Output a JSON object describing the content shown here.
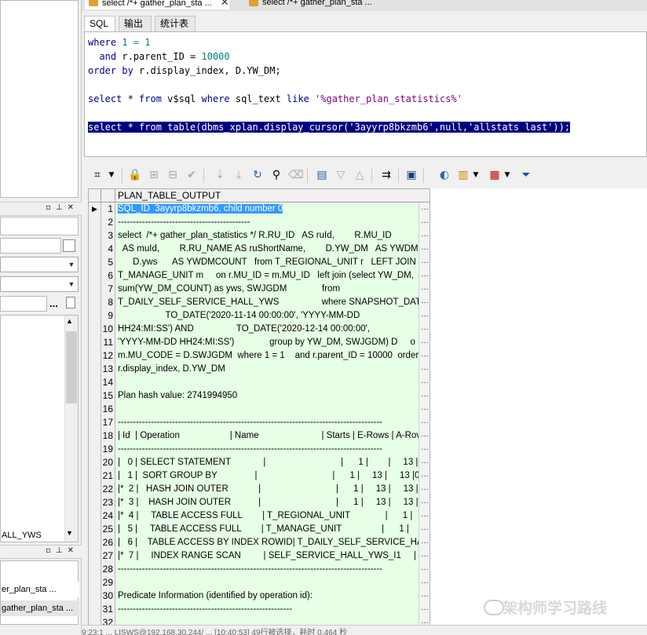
{
  "doc_tabs": [
    {
      "label": "select /*+ gather_plan_sta ..."
    },
    {
      "label": "select /*+ gather_plan_sta ..."
    }
  ],
  "sub_tabs": [
    "SQL",
    "输出",
    "统计表"
  ],
  "editor": {
    "lines": [
      [
        {
          "t": "where",
          "c": "kw"
        },
        {
          "t": " 1 = 1",
          "c": "num"
        }
      ],
      [
        {
          "t": "  and",
          "c": "kw"
        },
        {
          "t": " r.parent_ID = ",
          "c": ""
        },
        {
          "t": "10000",
          "c": "num"
        }
      ],
      [
        {
          "t": "order by",
          "c": "kw"
        },
        {
          "t": " r.display_index, D.YW_DM;",
          "c": ""
        }
      ],
      [],
      [
        {
          "t": "select",
          "c": "kw"
        },
        {
          "t": " * ",
          "c": ""
        },
        {
          "t": "from",
          "c": "kw"
        },
        {
          "t": " v$sql ",
          "c": ""
        },
        {
          "t": "where",
          "c": "kw"
        },
        {
          "t": " sql_text ",
          "c": ""
        },
        {
          "t": "like",
          "c": "kw"
        },
        {
          "t": " ",
          "c": ""
        },
        {
          "t": "'%gather_plan_statistics%'",
          "c": "str"
        }
      ],
      [],
      [
        {
          "t": "select * from table(dbms_xplan.display_cursor('3ayyrp8bkzmb6',null,'allstats last'));",
          "c": "sel"
        }
      ]
    ]
  },
  "grid": {
    "column_header": "PLAN_TABLE_OUTPUT",
    "ellipsis": "…",
    "current_row_marker": "▶",
    "rows": [
      {
        "n": "1",
        "text": "SQL_ID  3ayyrp8bkzmb6, child number 0",
        "highlight": true
      },
      {
        "n": "2",
        "text": "--------------------------------------------"
      },
      {
        "n": "3",
        "text": "select  /*+ gather_plan_statistics */ R.RU_ID   AS ruId,        R.MU_ID"
      },
      {
        "n": "4",
        "text": "  AS muId,        R.RU_NAME AS ruShortName,        D.YW_DM   AS YWDM,"
      },
      {
        "n": "5",
        "text": "      D.yws      AS YWDMCOUNT   from T_REGIONAL_UNIT r   LEFT JOIN"
      },
      {
        "n": "6",
        "text": "T_MANAGE_UNIT m     on r.MU_ID = m.MU_ID   left join (select YW_DM,"
      },
      {
        "n": "7",
        "text": "sum(YW_DM_COUNT) as yws, SWJGDM              from"
      },
      {
        "n": "8",
        "text": "T_DAILY_SELF_SERVICE_HALL_YWS                 where SNAPSHOT_DATE betw"
      },
      {
        "n": "9",
        "text": "                   TO_DATE('2020-11-14 00:00:00', 'YYYY-MM-DD"
      },
      {
        "n": "10",
        "text": "HH24:MI:SS') AND                 TO_DATE('2020-12-14 00:00:00',"
      },
      {
        "n": "11",
        "text": "'YYYY-MM-DD HH24:MI:SS')              group by YW_DM, SWJGDM) D     o"
      },
      {
        "n": "12",
        "text": "m.MU_CODE = D.SWJGDM  where 1 = 1    and r.parent_ID = 10000  order"
      },
      {
        "n": "13",
        "text": "r.display_index, D.YW_DM"
      },
      {
        "n": "14",
        "text": ""
      },
      {
        "n": "15",
        "text": "Plan hash value: 2741994950"
      },
      {
        "n": "16",
        "text": ""
      },
      {
        "n": "17",
        "text": "----------------------------------------------------------------------------------------"
      },
      {
        "n": "18",
        "text": "| Id  | Operation                    | Name                         | Starts | E-Rows | A-Rov"
      },
      {
        "n": "19",
        "text": "----------------------------------------------------------------------------------------"
      },
      {
        "n": "20",
        "text": "|   0 | SELECT STATEMENT             |                              |      1 |        |     13 |00:("
      },
      {
        "n": "21",
        "text": "|   1 |  SORT GROUP BY               |                              |      1 |     13 |     13 |00:0"
      },
      {
        "n": "22",
        "text": "|*  2 |   HASH JOIN OUTER            |                              |      1 |     13 |     13 |00"
      },
      {
        "n": "23",
        "text": "|*  3 |    HASH JOIN OUTER           |                              |      1 |     13 |     13 |00"
      },
      {
        "n": "24",
        "text": "|*  4 |     TABLE ACCESS FULL        | T_REGIONAL_UNIT              |      1 |     13"
      },
      {
        "n": "25",
        "text": "|   5 |     TABLE ACCESS FULL        | T_MANAGE_UNIT                |      1 |     45"
      },
      {
        "n": "26",
        "text": "|   6 |    TABLE ACCESS BY INDEX ROWID| T_DAILY_SELF_SERVICE_HALL_Y"
      },
      {
        "n": "27",
        "text": "|*  7 |     INDEX RANGE SCAN         | SELF_SERVICE_HALL_YWS_I1     |      1"
      },
      {
        "n": "28",
        "text": "----------------------------------------------------------------------------------------"
      },
      {
        "n": "29",
        "text": ""
      },
      {
        "n": "30",
        "text": "Predicate Information (identified by operation id):"
      },
      {
        "n": "31",
        "text": "----------------------------------------------------------"
      },
      {
        "n": "32",
        "text": ""
      }
    ]
  },
  "left_panel": {
    "list_tail": "ALL_YWS",
    "history": [
      "er_plan_sta ...",
      "gather_plan_sta ..."
    ],
    "ellipsis_button": "..."
  },
  "statusbar": {
    "text": "  9:23:1   ...   LISWS@192.168.30.244/   ...   [10:40:53] 49行被选择，耗时 0.464 秒"
  },
  "watermark": {
    "text": "架构师学习路线"
  }
}
